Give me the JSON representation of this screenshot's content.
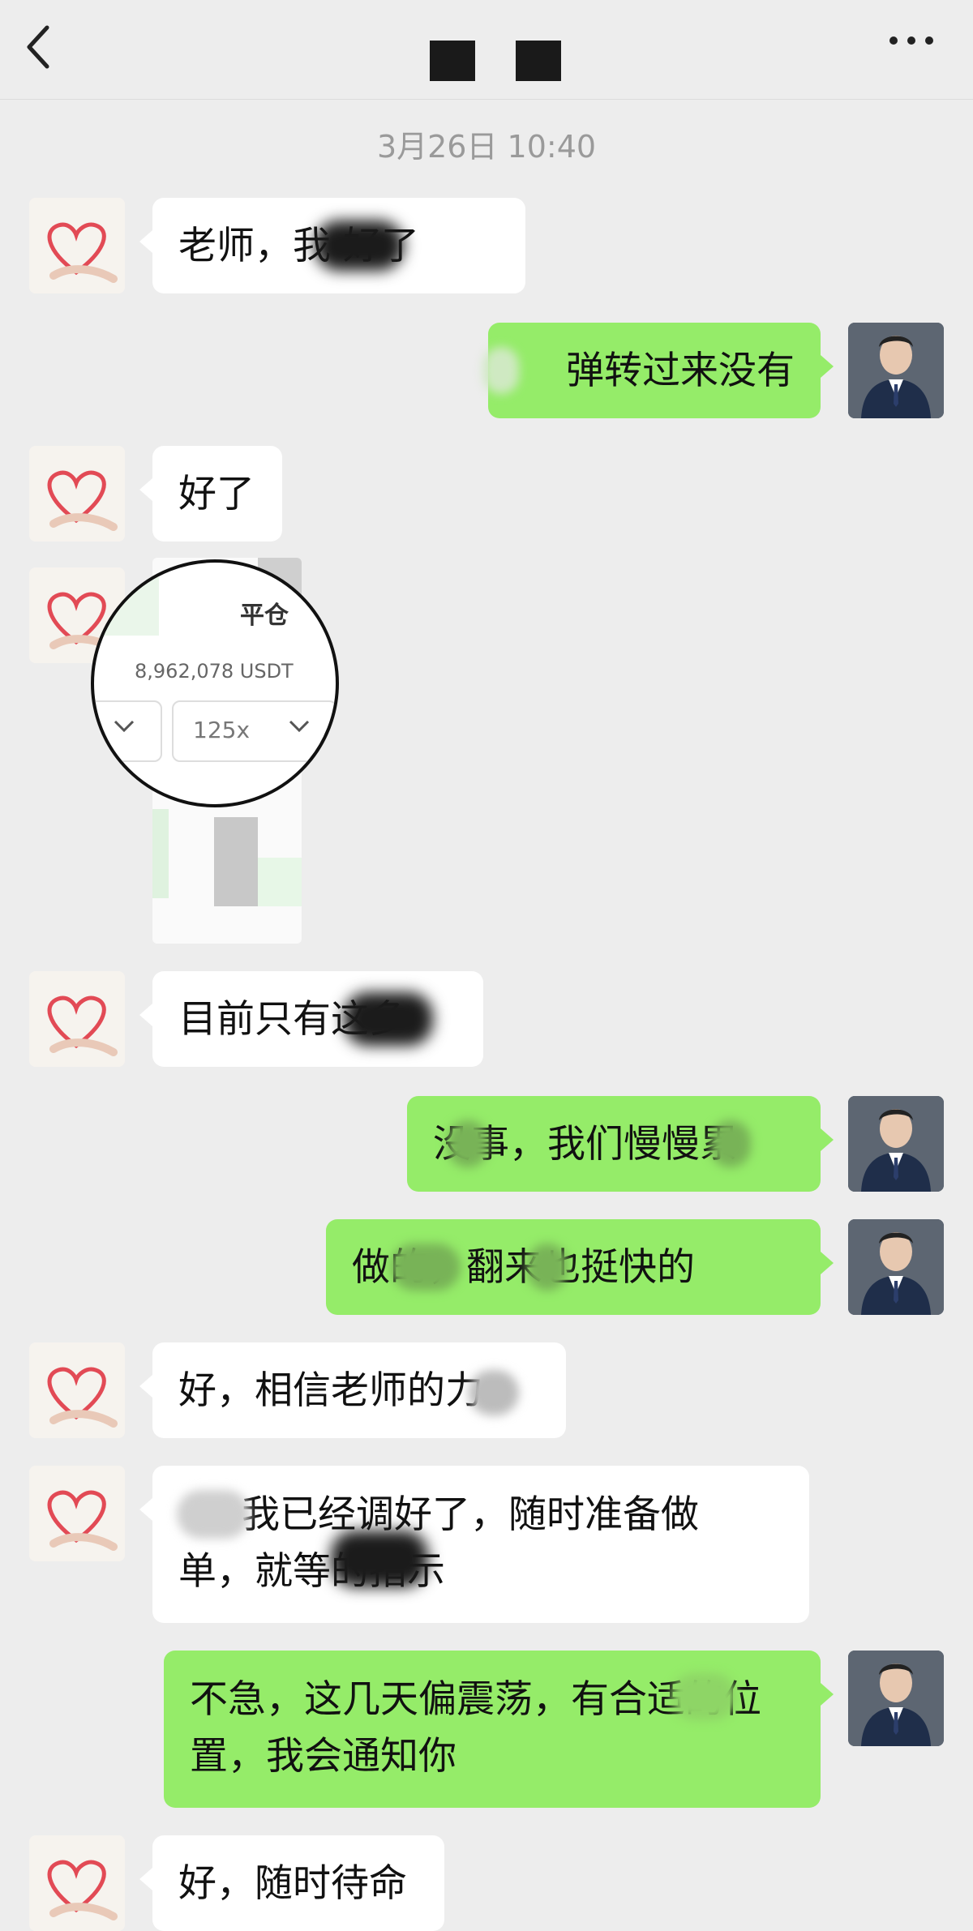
{
  "header": {
    "back_icon": "chevron-left-icon",
    "more_icon": "more-dots-icon"
  },
  "timestamp": "3月26日 10:40",
  "messages": [
    {
      "side": "left",
      "text": "老师，我  好了"
    },
    {
      "side": "right",
      "text": "弹转过来没有"
    },
    {
      "side": "left",
      "text": "好了"
    },
    {
      "side": "left",
      "type": "image",
      "image": {
        "title": "平仓",
        "amount": "8,962,078 USDT",
        "leverage": "125x"
      }
    },
    {
      "side": "left",
      "text": "目前只有这多"
    },
    {
      "side": "right",
      "text": "没事，我们慢慢累"
    },
    {
      "side": "right",
      "text": "做的，翻来也挺快的"
    },
    {
      "side": "left",
      "text": "好，相信老师的力"
    },
    {
      "side": "left",
      "text_line1": "我已经调好了，随时准备做",
      "text_line2": "单，就等的指示"
    },
    {
      "side": "right",
      "text_line1": "不急，这几天偏震荡，有合适的位",
      "text_line2": "置，我会通知你"
    },
    {
      "side": "left",
      "text": "好，随时待命"
    }
  ]
}
